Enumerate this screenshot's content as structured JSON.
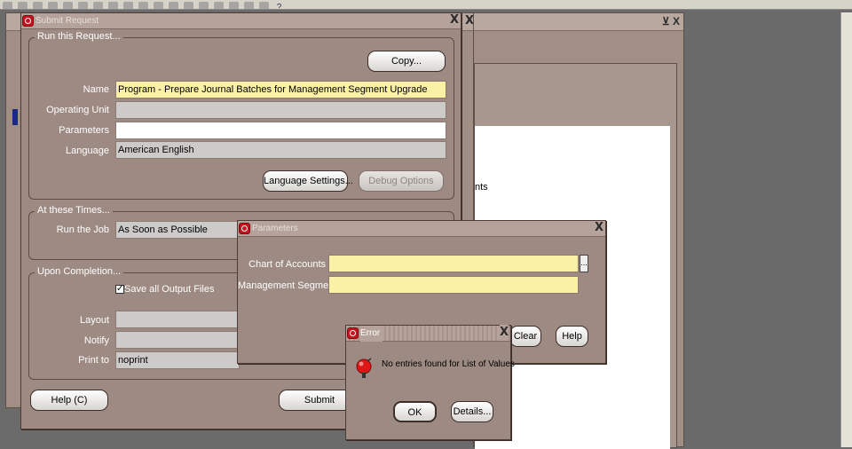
{
  "submit_request": {
    "title": "Submit Request",
    "close": "X",
    "run_request_label": "Run this Request...",
    "copy_label": "Copy...",
    "name_label": "Name",
    "name_value": "Program - Prepare Journal Batches for Management Segment Upgrade",
    "operating_unit_label": "Operating Unit",
    "operating_unit_value": "",
    "parameters_label": "Parameters",
    "parameters_value": "",
    "language_label": "Language",
    "language_value": "American English",
    "language_settings_label": "Language Settings...",
    "debug_options_label": "Debug Options",
    "at_these_times_label": "At these Times...",
    "run_job_label": "Run the Job",
    "run_job_value": "As Soon as Possible",
    "upon_completion_label": "Upon Completion...",
    "save_output_label": "Save all Output Files",
    "save_output_checked": "✓",
    "layout_label": "Layout",
    "layout_value": "",
    "notify_label": "Notify",
    "notify_value": "",
    "print_to_label": "Print to",
    "print_to_value": "noprint",
    "help_label": "Help (C)",
    "submit_label": "Submit"
  },
  "background": {
    "close": "X",
    "window_controls": "⊻ X",
    "partial_text": "nts"
  },
  "parameters": {
    "title": "Parameters",
    "close": "X",
    "chart_of_accounts_label": "Chart of Accounts",
    "chart_of_accounts_value": "",
    "management_segment_label": "Management Segment",
    "management_segment_value": "",
    "lov_button": "...",
    "clear_label": "Clear",
    "help_label": "Help"
  },
  "error": {
    "title": "Error",
    "close": "X",
    "message": "No entries found for List of Values",
    "ok_label": "OK",
    "details_label": "Details..."
  },
  "toolbar": {
    "help_glyph": "?"
  }
}
